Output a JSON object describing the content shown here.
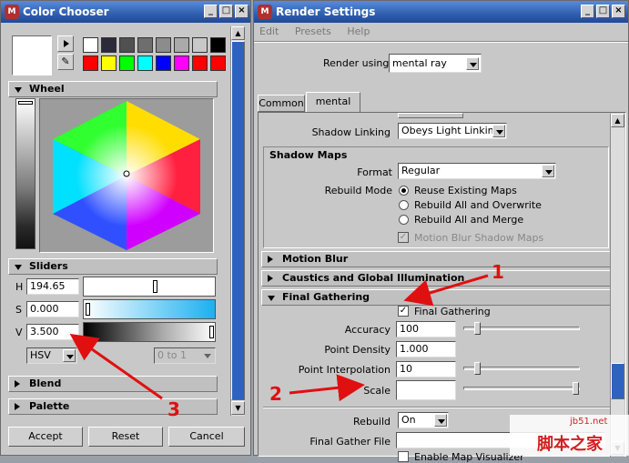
{
  "color_chooser": {
    "title": "Color Chooser",
    "palette_top": [
      "#ffffff",
      "#2a2a3a",
      "#505050",
      "#6e6e6e",
      "#8c8c8c",
      "#aaaaaa",
      "#c8c8c8",
      "#000000"
    ],
    "palette_bottom": [
      "#ff0000",
      "#ffff00",
      "#00ff00",
      "#00ffff",
      "#0000ff",
      "#ff00ff",
      "#ff0000",
      "#ff0000"
    ],
    "current_color": "#ffffff",
    "wheel": {
      "label": "Wheel"
    },
    "sliders": {
      "label": "Sliders",
      "h_label": "H",
      "h_value": "194.65",
      "s_label": "S",
      "s_value": "0.000",
      "v_label": "V",
      "v_value": "3.500",
      "mode": "HSV",
      "range": "0 to 1"
    },
    "blend_label": "Blend",
    "palette_label": "Palette",
    "accept": "Accept",
    "reset": "Reset",
    "cancel": "Cancel"
  },
  "render_settings": {
    "title": "Render Settings",
    "menu": [
      "Edit",
      "Presets",
      "Help"
    ],
    "render_using_label": "Render using:",
    "render_using_value": "mental ray",
    "tabs": [
      "Common",
      "mental ray"
    ],
    "shadow_linking_label": "Shadow Linking",
    "shadow_linking_value": "Obeys Light Linking",
    "shadow_maps": {
      "label": "Shadow Maps",
      "format_label": "Format",
      "format_value": "Regular",
      "rebuild_mode_label": "Rebuild Mode",
      "options": [
        "Reuse Existing Maps",
        "Rebuild All and Overwrite",
        "Rebuild All and Merge"
      ],
      "motion_blur_shadow_maps": "Motion Blur Shadow Maps"
    },
    "motion_blur_label": "Motion Blur",
    "caustics_label": "Caustics and Global Illumination",
    "final_gathering": {
      "label": "Final Gathering",
      "checkbox_label": "Final Gathering",
      "accuracy_label": "Accuracy",
      "accuracy_value": "100",
      "point_density_label": "Point Density",
      "point_density_value": "1.000",
      "point_interpolation_label": "Point Interpolation",
      "point_interpolation_value": "10",
      "scale_label": "Scale",
      "rebuild_label": "Rebuild",
      "rebuild_value": "On",
      "final_gather_file_label": "Final Gather File",
      "enable_map_label": "Enable Map Visualizer"
    }
  },
  "annotations": {
    "n1": "1",
    "n2": "2",
    "n3": "3",
    "color": "#e01010"
  },
  "watermark": {
    "site": "jb51.net",
    "brand": "脚本之家"
  }
}
